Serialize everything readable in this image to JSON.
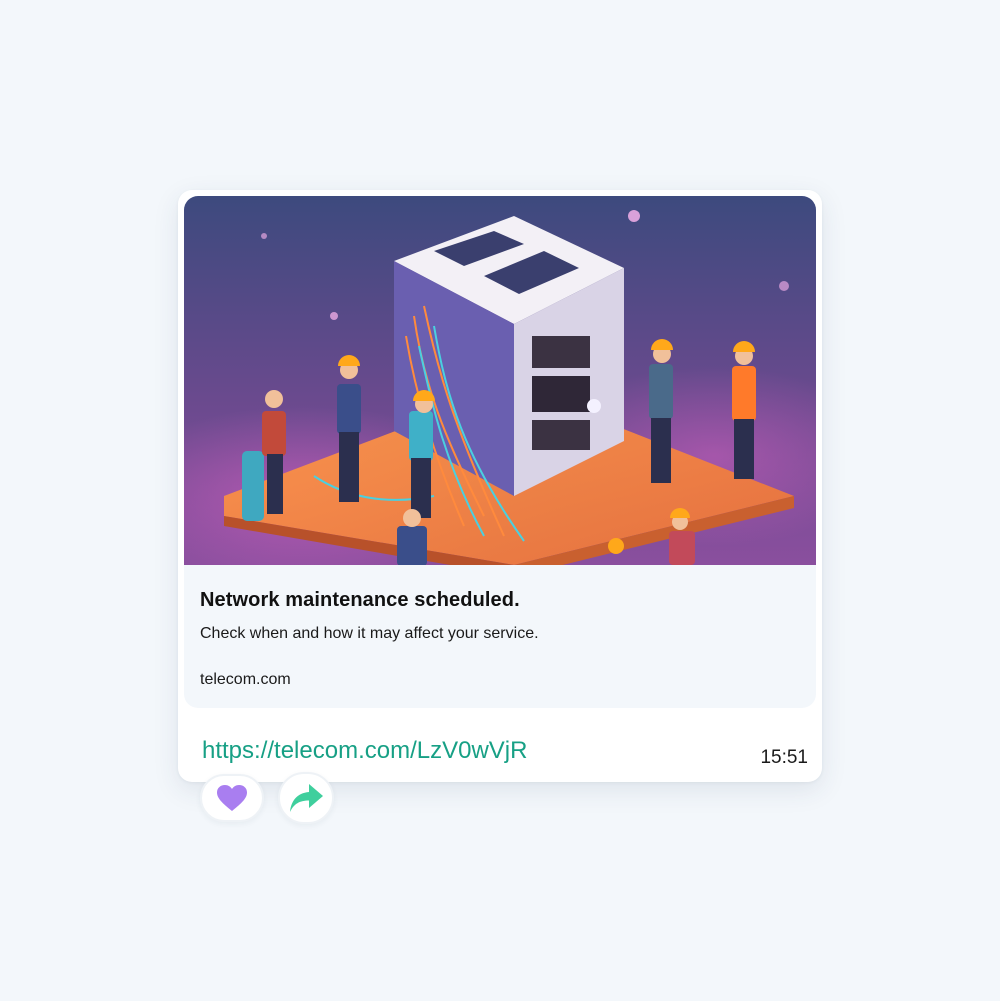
{
  "preview": {
    "title": "Network maintenance scheduled.",
    "description": "Check when and how it may affect your service.",
    "domain": "telecom.com",
    "image_icon": "isometric-server-maintenance-illustration"
  },
  "message": {
    "link": "https://telecom.com/LzV0wVjR",
    "time": "15:51"
  },
  "reactions": [
    {
      "icon": "heart-icon",
      "color": "#a97ef0"
    },
    {
      "icon": "share-arrow-icon",
      "color": "#3fcf9d"
    }
  ],
  "colors": {
    "background": "#f3f7fb",
    "link": "#17a085",
    "card": "#ffffff"
  }
}
